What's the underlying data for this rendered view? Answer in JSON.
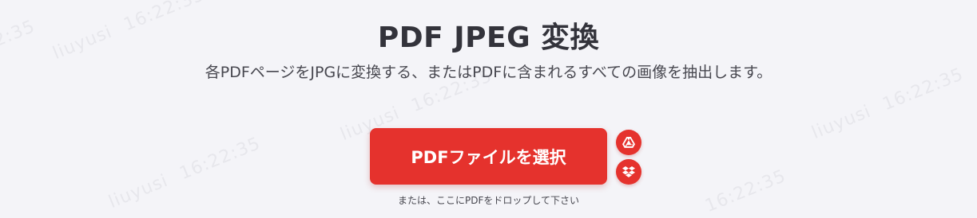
{
  "tool": {
    "title": "PDF JPEG 変換",
    "description": "各PDFページをJPGに変換する、またはPDFに含まれるすべての画像を抽出します。",
    "select_button_label": "PDFファイルを選択",
    "drop_hint": "または、ここにPDFをドロップして下さい"
  },
  "cloud_buttons": [
    {
      "name": "Google Drive",
      "icon": "google-drive-icon"
    },
    {
      "name": "Dropbox",
      "icon": "dropbox-icon"
    }
  ],
  "watermark": {
    "user": "liuyusi",
    "time": "16:22:35"
  },
  "colors": {
    "accent": "#e5322d",
    "background": "#f4f4f8",
    "text": "#33333b"
  }
}
